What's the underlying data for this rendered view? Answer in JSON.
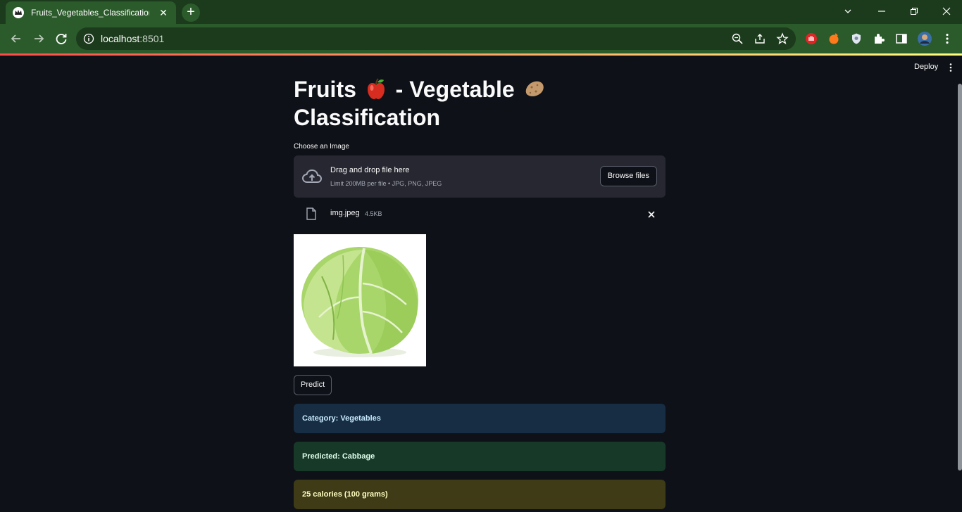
{
  "browser": {
    "tab_title": "Fruits_Vegetables_Classification",
    "url_host": "localhost",
    "url_port": ":8501"
  },
  "app": {
    "deploy_label": "Deploy",
    "title_part1": "Fruits",
    "title_part2": " - Vegetable",
    "title_part3": "Classification",
    "title_emoji1": "apple-icon",
    "title_emoji2": "potato-icon",
    "uploader": {
      "label": "Choose an Image",
      "drop_text": "Drag and drop file here",
      "limit_text": "Limit 200MB per file • JPG, PNG, JPEG",
      "browse_label": "Browse files"
    },
    "file": {
      "name": "img.jpeg",
      "size": "4.5KB"
    },
    "predict_label": "Predict",
    "results": {
      "category": "Category: Vegetables",
      "predicted": "Predicted: Cabbage",
      "calories": "25 calories (100 grams)"
    },
    "colors": {
      "background": "#0e1117",
      "info": "#172d43",
      "success": "#173928",
      "warning": "#3e3b16"
    }
  }
}
